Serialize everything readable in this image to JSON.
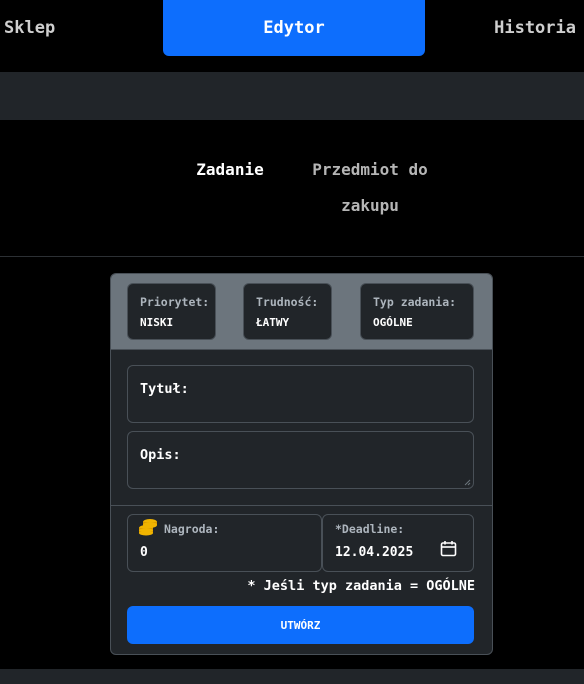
{
  "nav": {
    "items": [
      {
        "label": "Sklep"
      },
      {
        "label": "Edytor"
      },
      {
        "label": "Historia"
      }
    ]
  },
  "subtabs": {
    "active": "Zadanie",
    "other_line1": "Przedmiot do",
    "other_line2": "zakupu"
  },
  "form": {
    "priority": {
      "label": "Priorytet:",
      "value": "NISKI"
    },
    "difficulty": {
      "label": "Trudność:",
      "value": "ŁATWY"
    },
    "type": {
      "label": "Typ zadania:",
      "value": "OGÓLNE"
    },
    "title_label": "Tytuł:",
    "description_label": "Opis:",
    "reward": {
      "label": "Nagroda:",
      "value": "0"
    },
    "deadline": {
      "label": "*Deadline:",
      "value": "12.04.2025"
    },
    "note": "* Jeśli typ zadania = OGÓLNE",
    "submit_label": "UTWÓRZ"
  },
  "colors": {
    "accent": "#0d6efd",
    "panel": "#212529",
    "header": "#6c757d"
  },
  "icons": {
    "reward": "coins-icon",
    "deadline": "calendar-icon"
  }
}
